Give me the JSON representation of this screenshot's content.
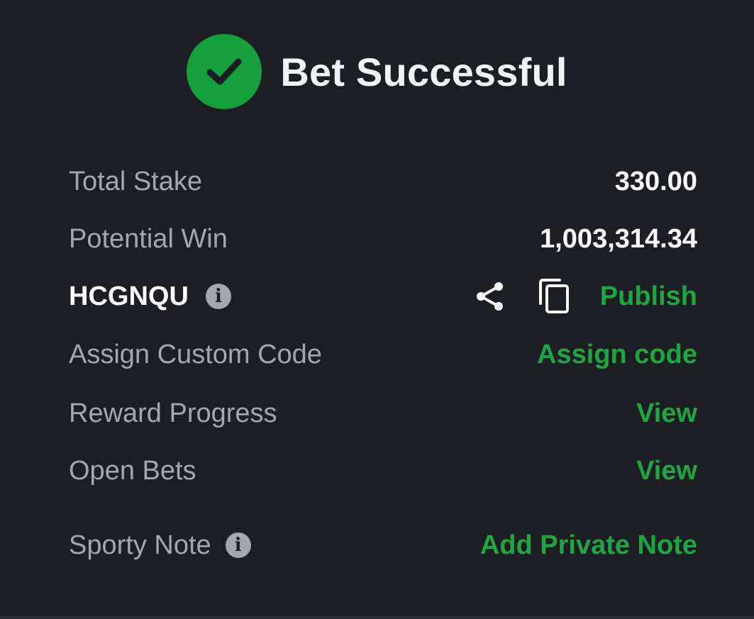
{
  "header": {
    "title": "Bet Successful",
    "icon": "check-circle-icon",
    "accent_color": "#14a03a"
  },
  "summary": {
    "total_stake_label": "Total Stake",
    "total_stake_value": "330.00",
    "potential_win_label": "Potential Win",
    "potential_win_value": "1,003,314.34"
  },
  "booking": {
    "code": "HCGNQU",
    "info_icon": "i",
    "share_icon": "share-icon",
    "copy_icon": "copy-icon",
    "publish_label": "Publish"
  },
  "custom_code": {
    "label": "Assign Custom Code",
    "action": "Assign code"
  },
  "reward": {
    "label": "Reward Progress",
    "action": "View"
  },
  "open_bets": {
    "label": "Open Bets",
    "action": "View"
  },
  "note": {
    "label": "Sporty Note",
    "info_icon": "i",
    "action": "Add Private Note"
  },
  "colors": {
    "background": "#1c1e24",
    "link": "#1ea741",
    "muted_text": "#a2a7b0",
    "primary_text": "#ffffff"
  }
}
